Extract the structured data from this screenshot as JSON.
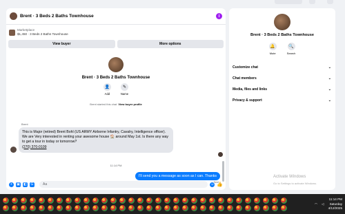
{
  "chat": {
    "title": "Brent · 3 Beds 2 Baths Townhouse",
    "marketplace_label": "Marketplace",
    "listing": "$1,450 · 3 Beds 2 Baths Townhouse",
    "view_buyer": "View buyer",
    "more_options": "More options",
    "profile_name": "Brent · 3 Beds 2 Baths Townhouse",
    "add_label": "Add",
    "name_label": "Name",
    "started_text": "Brent started this chat.",
    "view_profile": "View buyer profile",
    "sender": "Brent",
    "incoming_message": "This is Major (retired) Brent Bohl (US ARMY Airborne Infantry, Cavalry, Intelligence officer). We are Very interested in renting your awesome house 🏠 around May 1st. Is there any way to get a tour in today or tomorrow?",
    "phone": "(270) 370-0109",
    "timestamp": "11:14 PM",
    "outgoing_message": "I'll send you a message as soon as I can. Thanks",
    "sent_label": "Sent",
    "composer_placeholder": "Aa"
  },
  "right_panel": {
    "name": "Brent · 3 Beds 2 Baths Townhouse",
    "mute": "Mute",
    "search": "Search",
    "menu": [
      "Customize chat",
      "Chat members",
      "Media, files and links",
      "Privacy & support"
    ]
  },
  "watermark": {
    "title": "Activate Windows",
    "subtitle": "Go to Settings to activate Windows."
  },
  "taskbar": {
    "time": "11:14 PM",
    "day": "Saturday",
    "date": "4/12/2025"
  }
}
